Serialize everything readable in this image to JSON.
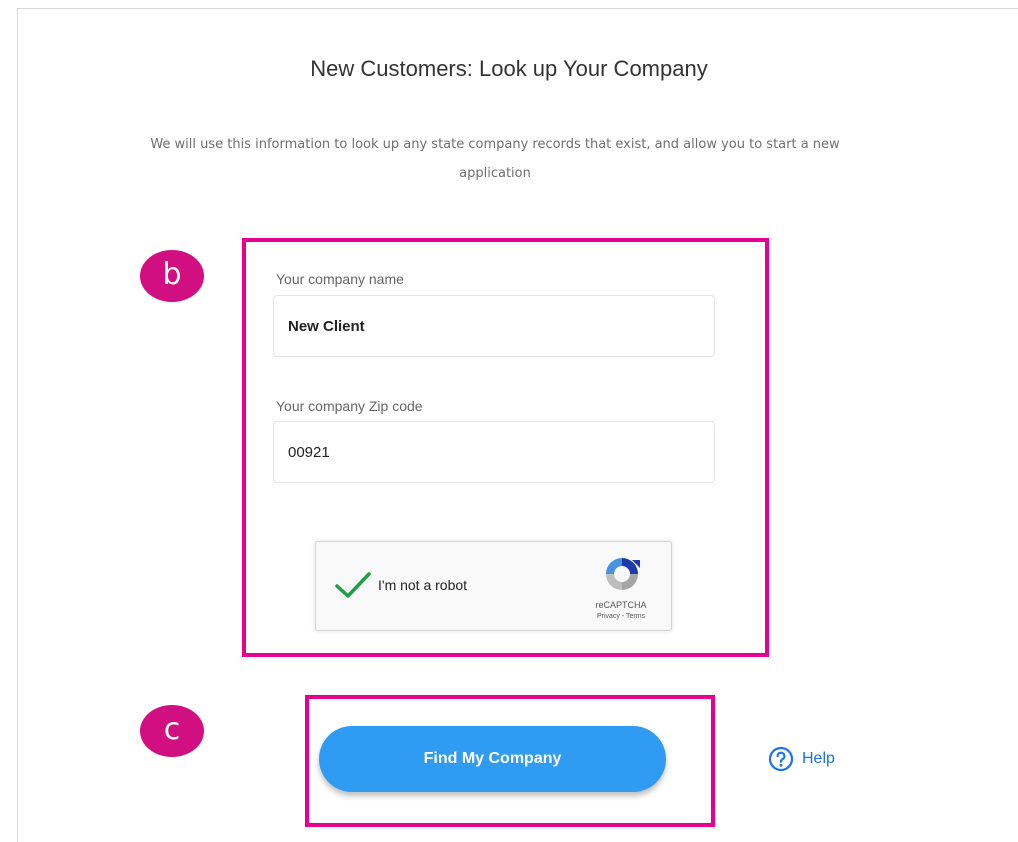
{
  "page": {
    "title": "New Customers: Look up Your Company",
    "subtitle": "We will use this information to look up any state company records that exist, and allow you to start a new application"
  },
  "annotations": {
    "marker_b": "b",
    "marker_c": "c",
    "highlight_color": "#e6008f",
    "marker_color": "#d10f80"
  },
  "form": {
    "company_name_label": "Your company name",
    "company_name_value": "New Client",
    "zip_label": "Your company Zip code",
    "zip_value": "00921"
  },
  "recaptcha": {
    "checked": true,
    "label": "I'm not a robot",
    "brand": "reCAPTCHA",
    "links": "Privacy - Terms",
    "check_color": "#1e9e45"
  },
  "actions": {
    "find_button_label": "Find My Company",
    "find_button_color": "#2f9bf3",
    "help_label": "Help",
    "help_color": "#1a73e8"
  }
}
